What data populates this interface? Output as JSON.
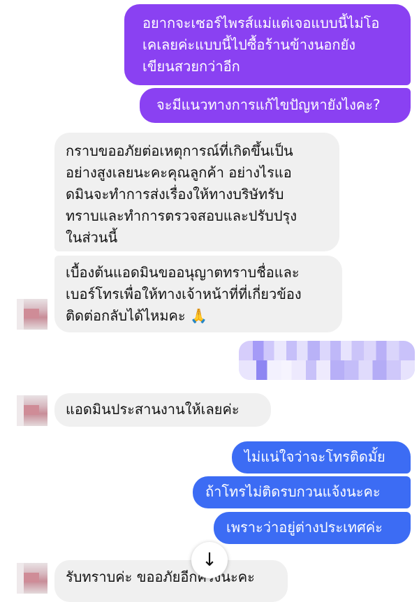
{
  "colors": {
    "outgoing_purple": "#8a41f2",
    "outgoing_blue": "#3c6cf4",
    "incoming_bg": "#f0f0f0"
  },
  "messages": [
    {
      "id": "m1",
      "side": "out",
      "text": "อยากจะเซอร์ไพรส์แม่แต่เจอแบบนี้ไม่โอ\nเคเลยค่ะแบบนี้ไปซื้อร้านข้างนอกยัง\nเขียนสวยกว่าอีก"
    },
    {
      "id": "m2",
      "side": "out",
      "text": "จะมีแนวทางการแก้ไขปัญหายังไงคะ?"
    },
    {
      "id": "m3",
      "side": "in",
      "text": "กราบขออภัยต่อเหตุการณ์ที่เกิดขึ้นเป็น\nอย่างสูงเลยนะคะคุณลูกค้า อย่างไรแอ\nดมินจะทำการส่งเรื่องให้ทางบริษัทรับ\nทราบและทำการตรวจสอบและปรับปรุง\nในส่วนนี้"
    },
    {
      "id": "m4",
      "side": "in",
      "text": "เบื้องต้นแอดมินขออนุญาตทราบชื่อและ\nเบอร์โทรเพื่อให้ทางเจ้าหน้าที่ที่เกี่ยวข้อง\nติดต่อกลับได้ไหมคะ 🙏"
    },
    {
      "id": "m5",
      "side": "out",
      "text": ""
    },
    {
      "id": "m6",
      "side": "in",
      "text": "แอดมินประสานงานให้เลยค่ะ"
    },
    {
      "id": "m7",
      "side": "out",
      "text": "ไม่แน่ใจว่าจะโทรติดมั้ย"
    },
    {
      "id": "m8",
      "side": "out",
      "text": "ถ้าโทรไม่ติดรบกวนแจ้งนะคะ"
    },
    {
      "id": "m9",
      "side": "out",
      "text": "เพราะว่าอยู่ต่างประเทศค่ะ"
    },
    {
      "id": "m10",
      "side": "in",
      "text": "รับทราบค่ะ ขออภัยอีกครั้งนะคะ"
    }
  ],
  "icons": {
    "scroll_down": "arrow-down-icon",
    "scroll_down_glyph": "↓"
  }
}
